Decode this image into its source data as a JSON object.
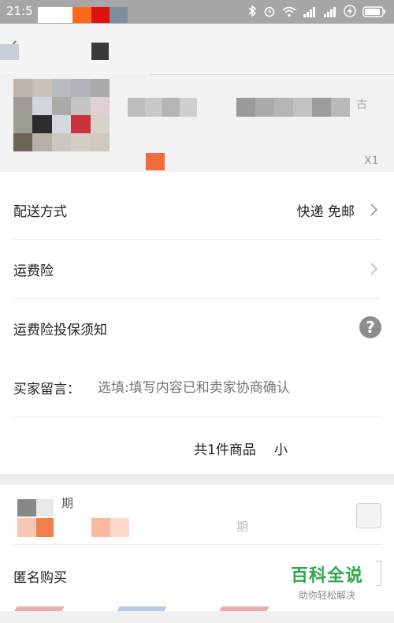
{
  "status_bar": {
    "time": "21:5"
  },
  "product": {
    "frag_a": "古",
    "frag_b": "X1"
  },
  "options": {
    "delivery": {
      "label": "配送方式",
      "value": "快递 免邮"
    },
    "shipping_insurance": {
      "label": "运费险"
    },
    "insurance_notice": {
      "label": "运费险投保须知",
      "help": "?"
    },
    "message": {
      "label": "买家留言：",
      "placeholder": "选填:填写内容已和卖家协商确认"
    }
  },
  "total": {
    "items_text": "共1件商品",
    "subtotal_frag": "小"
  },
  "second_card": {
    "frag_a": "期",
    "frag_b": "期"
  },
  "anonymous": {
    "label": "匿名购买"
  },
  "watermark": {
    "title": "百科全说",
    "subtitle": "助你轻松解决"
  },
  "colors": {
    "orange": "#f26c3a",
    "red": "#e02020",
    "green": "#2ea84a"
  }
}
